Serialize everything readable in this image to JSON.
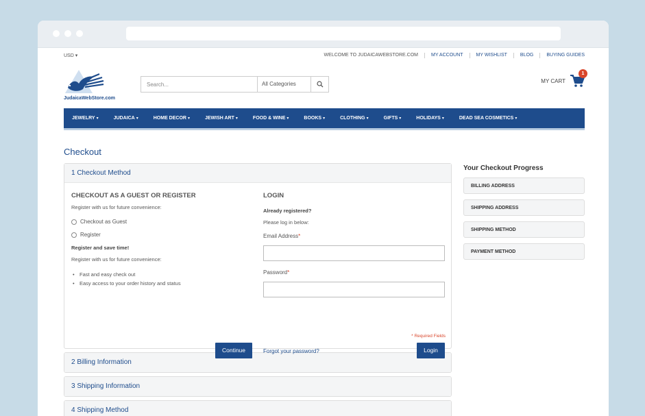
{
  "topbar": {
    "currency": "USD",
    "links": [
      "WELCOME TO JUDAICAWEBSTORE.COM",
      "MY ACCOUNT",
      "MY WISHLIST",
      "BLOG",
      "BUYING GUIDES"
    ]
  },
  "header": {
    "logo_text": "JudaicaWebStore.com",
    "search_placeholder": "Search...",
    "category_select": "All Categories",
    "cart_label": "MY CART",
    "cart_count": "1"
  },
  "nav": [
    "JEWELRY",
    "JUDAICA",
    "HOME DECOR",
    "JEWISH ART",
    "FOOD & WINE",
    "BOOKS",
    "CLOTHING",
    "GIFTS",
    "HOLIDAYS",
    "DEAD SEA COSMETICS"
  ],
  "page_title": "Checkout",
  "checkout": {
    "step1_title": "1 Checkout Method",
    "guest": {
      "heading": "CHECKOUT AS A GUEST OR REGISTER",
      "intro": "Register with us for future convenience:",
      "option_guest": "Checkout as Guest",
      "option_register": "Register",
      "save_time": "Register and save time!",
      "register_note": "Register with us for future convenience:",
      "benefits": [
        "Fast and easy check out",
        "Easy access to your order history and status"
      ],
      "continue_button": "Continue"
    },
    "login": {
      "heading": "LOGIN",
      "already": "Already registered?",
      "please": "Please log in below:",
      "email_label": "Email Address",
      "password_label": "Password",
      "required_mark": "*",
      "required_note": "* Required Fields",
      "forgot_link": "Forgot your password?",
      "login_button": "Login"
    },
    "steps": [
      "2 Billing Information",
      "3 Shipping Information",
      "4 Shipping Method"
    ]
  },
  "progress": {
    "title": "Your Checkout Progress",
    "items": [
      "BILLING ADDRESS",
      "SHIPPING ADDRESS",
      "SHIPPING METHOD",
      "PAYMENT METHOD"
    ]
  },
  "colors": {
    "brand": "#1e4c8c",
    "required": "#d9462b",
    "background": "#c7dbe7"
  }
}
